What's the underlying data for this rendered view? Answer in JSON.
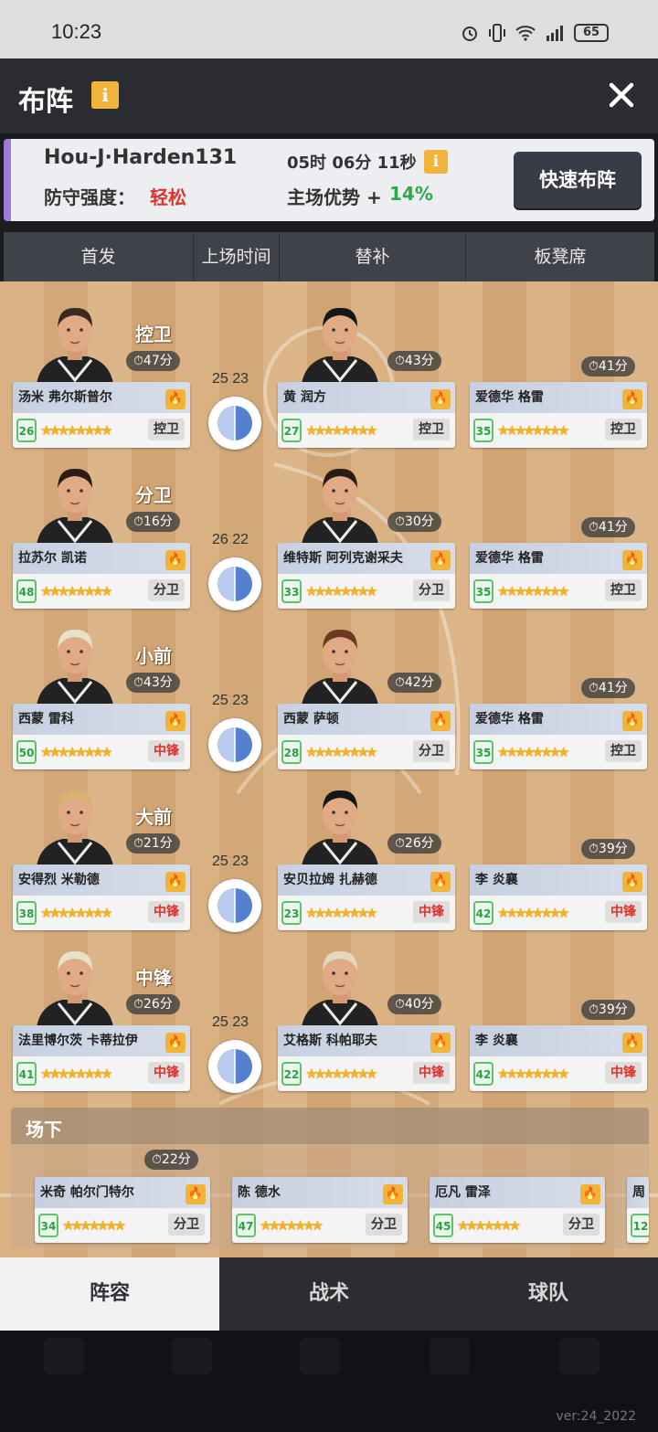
{
  "status": {
    "time": "10:23",
    "battery": "65"
  },
  "header": {
    "title": "布阵",
    "info_icon": "info-icon",
    "close_icon": "close-icon"
  },
  "opponent": {
    "name": "Hou-J·Harden131",
    "countdown": "05时 06分 11秒",
    "defense_label": "防守强度：",
    "defense_value": "轻松",
    "home_label": "主场优势 +",
    "home_value": "14%",
    "quick_button": "快速布阵"
  },
  "tabs": [
    "首发",
    "上场时间",
    "替补",
    "板凳席"
  ],
  "rows": [
    {
      "position": "控卫",
      "score": "25 23",
      "starter": {
        "name": "汤米 弗尔斯普尔",
        "minutes": "47分",
        "level": "26",
        "pos": "控卫",
        "red": false
      },
      "sub": {
        "name": "黄 润方",
        "minutes": "43分",
        "level": "27",
        "pos": "控卫",
        "red": false
      },
      "bench": {
        "name": "爱德华 格雷",
        "minutes": "41分",
        "level": "35",
        "pos": "控卫",
        "red": false
      }
    },
    {
      "position": "分卫",
      "score": "26 22",
      "starter": {
        "name": "拉苏尔 凯诺",
        "minutes": "16分",
        "level": "48",
        "pos": "分卫",
        "red": false
      },
      "sub": {
        "name": "维特斯 阿列克谢采夫",
        "minutes": "30分",
        "level": "33",
        "pos": "分卫",
        "red": false
      },
      "bench": {
        "name": "爱德华 格雷",
        "minutes": "41分",
        "level": "35",
        "pos": "控卫",
        "red": false
      }
    },
    {
      "position": "小前",
      "score": "25 23",
      "starter": {
        "name": "西蒙 雷科",
        "minutes": "43分",
        "level": "50",
        "pos": "中锋",
        "red": true
      },
      "sub": {
        "name": "西蒙 萨顿",
        "minutes": "42分",
        "level": "28",
        "pos": "分卫",
        "red": false
      },
      "bench": {
        "name": "爱德华 格雷",
        "minutes": "41分",
        "level": "35",
        "pos": "控卫",
        "red": false
      }
    },
    {
      "position": "大前",
      "score": "25 23",
      "starter": {
        "name": "安得烈 米勒德",
        "minutes": "21分",
        "level": "38",
        "pos": "中锋",
        "red": true
      },
      "sub": {
        "name": "安贝拉姆 扎赫德",
        "minutes": "26分",
        "level": "23",
        "pos": "中锋",
        "red": true
      },
      "bench": {
        "name": "李 炎襄",
        "minutes": "39分",
        "level": "42",
        "pos": "中锋",
        "red": true
      }
    },
    {
      "position": "中锋",
      "score": "25 23",
      "starter": {
        "name": "法里博尔茨 卡蒂拉伊",
        "minutes": "26分",
        "level": "41",
        "pos": "中锋",
        "red": true
      },
      "sub": {
        "name": "艾格斯 科帕耶夫",
        "minutes": "40分",
        "level": "22",
        "pos": "中锋",
        "red": true
      },
      "bench": {
        "name": "李 炎襄",
        "minutes": "39分",
        "level": "42",
        "pos": "中锋",
        "red": true
      }
    }
  ],
  "bench_section": {
    "title": "场下",
    "minutes": "22分",
    "players": [
      {
        "name": "米奇 帕尔门特尔",
        "level": "34",
        "pos": "分卫"
      },
      {
        "name": "陈 德水",
        "level": "47",
        "pos": "分卫"
      },
      {
        "name": "厄凡 雷泽",
        "level": "45",
        "pos": "分卫"
      },
      {
        "name": "周",
        "level": "12",
        "pos": ""
      }
    ]
  },
  "bottom_tabs": [
    "阵容",
    "战术",
    "球队"
  ],
  "version": "ver:24_2022",
  "colors": {
    "accent": "#f1b43b",
    "danger": "#e0312b",
    "positive": "#2fa84a",
    "header": "#2b2c31"
  }
}
